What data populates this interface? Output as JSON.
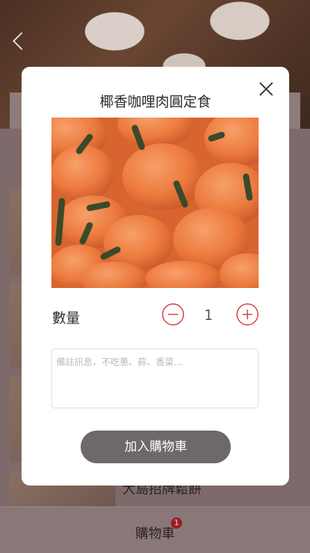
{
  "background": {
    "item_title": "大島招牌鬆餅",
    "cart": {
      "label": "購物車",
      "badge": "1"
    }
  },
  "modal": {
    "title": "椰香咖哩肉圓定食",
    "quantity_label": "數量",
    "quantity": "1",
    "note_placeholder": "備註訊息，不吃蔥、蒜、香菜...",
    "add_to_cart_label": "加入購物車"
  },
  "icons": [
    "back-arrow-icon",
    "close-icon",
    "minus-icon",
    "plus-icon"
  ],
  "colors": {
    "accent": "#d9363e",
    "button": "#6e6868",
    "badge": "#9a1d22"
  }
}
